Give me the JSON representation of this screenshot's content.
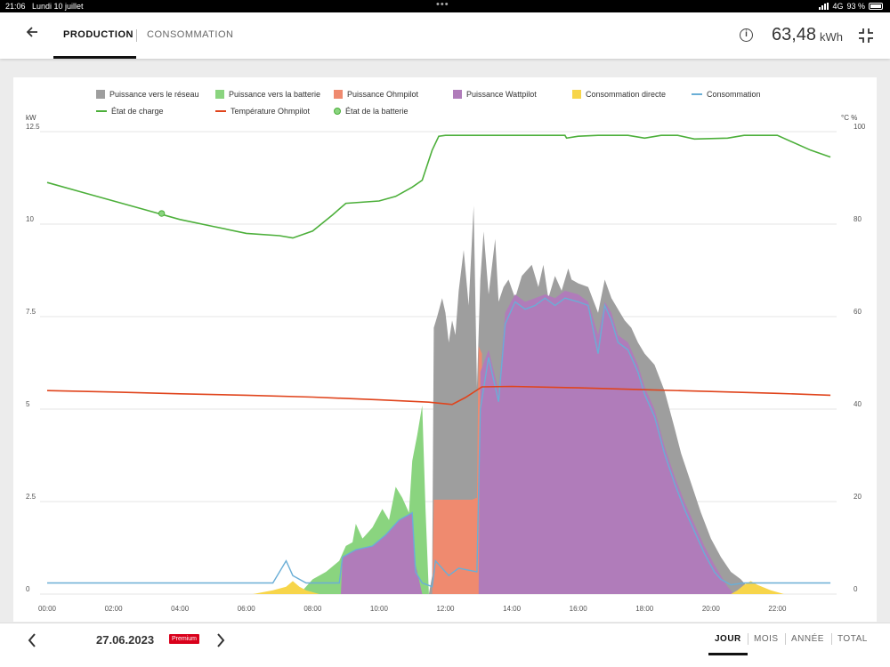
{
  "status_bar": {
    "time": "21:06",
    "date": "Lundi 10 juillet",
    "dots": "•••",
    "network": "4G",
    "battery": "93 %"
  },
  "header": {
    "tabs": [
      {
        "label": "PRODUCTION",
        "active": true
      },
      {
        "label": "CONSOMMATION",
        "active": false
      }
    ],
    "total_value": "63,48",
    "total_unit": "kWh",
    "icons": [
      "back-arrow-icon",
      "info-icon",
      "collapse-icon"
    ]
  },
  "footer": {
    "date": "27.06.2023",
    "badge": "Premium",
    "periods": [
      {
        "label": "JOUR",
        "active": true
      },
      {
        "label": "MOIS",
        "active": false
      },
      {
        "label": "ANNÉE",
        "active": false
      },
      {
        "label": "TOTAL",
        "active": false
      }
    ]
  },
  "chart_data": {
    "type": "area",
    "legend": [
      {
        "label": "Puissance vers le réseau",
        "color": "#9e9e9e",
        "kind": "area"
      },
      {
        "label": "Puissance vers la batterie",
        "color": "#8ad47f",
        "kind": "area"
      },
      {
        "label": "Puissance Ohmpilot",
        "color": "#ef8a6f",
        "kind": "area"
      },
      {
        "label": "Puissance Wattpilot",
        "color": "#b07cba",
        "kind": "area"
      },
      {
        "label": "Consommation directe",
        "color": "#f7d54a",
        "kind": "area"
      },
      {
        "label": "Consommation",
        "color": "#6aaed6",
        "kind": "line"
      },
      {
        "label": "État de charge",
        "color": "#4caf3a",
        "kind": "line"
      },
      {
        "label": "Température Ohmpilot",
        "color": "#e0441c",
        "kind": "line"
      },
      {
        "label": "État de la batterie",
        "color": "#8ad47f",
        "kind": "dot"
      }
    ],
    "y_left": {
      "unit": "kW",
      "min": 0,
      "max": 12.5,
      "ticks": [
        "0",
        "2.5",
        "5",
        "7.5",
        "10",
        "12.5"
      ]
    },
    "y_right": {
      "unit": "°C  %",
      "min": 0,
      "max": 100,
      "ticks": [
        "0",
        "20",
        "40",
        "60",
        "80",
        "100"
      ]
    },
    "x_ticks": [
      "00:00",
      "02:00",
      "04:00",
      "06:00",
      "08:00",
      "10:00",
      "12:00",
      "14:00",
      "16:00",
      "18:00",
      "20:00",
      "22:00"
    ],
    "x_range_hours": [
      0,
      24
    ],
    "grid": true,
    "series": [
      {
        "name": "Puissance vers le réseau",
        "color": "#9e9e9e",
        "points": [
          [
            11.5,
            0
          ],
          [
            11.6,
            0.5
          ],
          [
            11.65,
            7.2
          ],
          [
            11.75,
            7.5
          ],
          [
            11.9,
            8.0
          ],
          [
            12.0,
            7.6
          ],
          [
            12.1,
            6.8
          ],
          [
            12.2,
            7.4
          ],
          [
            12.3,
            7.0
          ],
          [
            12.4,
            8.2
          ],
          [
            12.55,
            9.3
          ],
          [
            12.7,
            7.8
          ],
          [
            12.85,
            10.5
          ],
          [
            12.95,
            5.6
          ],
          [
            13.05,
            8.5
          ],
          [
            13.15,
            9.8
          ],
          [
            13.3,
            8.1
          ],
          [
            13.5,
            9.6
          ],
          [
            13.6,
            7.9
          ],
          [
            13.75,
            8.3
          ],
          [
            13.9,
            8.5
          ],
          [
            14.1,
            8.0
          ],
          [
            14.3,
            8.6
          ],
          [
            14.6,
            8.9
          ],
          [
            14.8,
            8.3
          ],
          [
            14.95,
            8.9
          ],
          [
            15.1,
            8.0
          ],
          [
            15.3,
            8.6
          ],
          [
            15.5,
            8.2
          ],
          [
            15.7,
            8.8
          ],
          [
            15.8,
            8.5
          ],
          [
            16.0,
            8.4
          ],
          [
            16.3,
            8.3
          ],
          [
            16.6,
            7.6
          ],
          [
            16.8,
            8.5
          ],
          [
            17.0,
            8.0
          ],
          [
            17.2,
            7.7
          ],
          [
            17.4,
            7.4
          ],
          [
            17.6,
            7.2
          ],
          [
            17.8,
            6.8
          ],
          [
            18.0,
            6.5
          ],
          [
            18.3,
            6.2
          ],
          [
            18.6,
            5.5
          ],
          [
            18.9,
            4.5
          ],
          [
            19.1,
            3.8
          ],
          [
            19.4,
            3.0
          ],
          [
            19.7,
            2.2
          ],
          [
            20.0,
            1.5
          ],
          [
            20.3,
            1.0
          ],
          [
            20.6,
            0.6
          ],
          [
            20.9,
            0.4
          ],
          [
            21.1,
            0.2
          ],
          [
            21.4,
            0
          ]
        ]
      },
      {
        "name": "Puissance vers la batterie",
        "color": "#8ad47f",
        "points": [
          [
            7.6,
            0
          ],
          [
            8.0,
            0.4
          ],
          [
            8.4,
            0.6
          ],
          [
            8.8,
            0.9
          ],
          [
            9.0,
            1.3
          ],
          [
            9.2,
            1.4
          ],
          [
            9.3,
            1.9
          ],
          [
            9.5,
            1.5
          ],
          [
            9.8,
            1.8
          ],
          [
            10.1,
            2.3
          ],
          [
            10.3,
            2.0
          ],
          [
            10.5,
            2.9
          ],
          [
            10.7,
            2.6
          ],
          [
            10.9,
            2.2
          ],
          [
            11.0,
            3.6
          ],
          [
            11.15,
            4.3
          ],
          [
            11.3,
            5.1
          ],
          [
            11.4,
            2.3
          ],
          [
            11.5,
            0
          ]
        ]
      },
      {
        "name": "Puissance Ohmpilot",
        "color": "#ef8a6f",
        "points": [
          [
            11.6,
            0
          ],
          [
            11.65,
            2.55
          ],
          [
            12.1,
            2.55
          ],
          [
            12.8,
            2.55
          ],
          [
            12.95,
            2.6
          ],
          [
            13.0,
            6.7
          ],
          [
            13.1,
            6.5
          ]
        ]
      },
      {
        "name": "Puissance Wattpilot",
        "color": "#b07cba",
        "points": [
          [
            8.85,
            0
          ],
          [
            8.9,
            1.0
          ],
          [
            9.3,
            1.2
          ],
          [
            9.8,
            1.3
          ],
          [
            10.2,
            1.6
          ],
          [
            10.6,
            2.0
          ],
          [
            11.0,
            2.2
          ],
          [
            11.1,
            0.8
          ],
          [
            11.3,
            0
          ],
          [
            13.0,
            0
          ],
          [
            13.05,
            6.0
          ],
          [
            13.3,
            6.6
          ],
          [
            13.6,
            5.5
          ],
          [
            13.8,
            7.6
          ],
          [
            14.1,
            8.1
          ],
          [
            14.4,
            7.9
          ],
          [
            14.7,
            8.0
          ],
          [
            15.0,
            8.1
          ],
          [
            15.3,
            8.0
          ],
          [
            15.6,
            8.2
          ],
          [
            16.0,
            8.1
          ],
          [
            16.3,
            7.9
          ],
          [
            16.6,
            7.0
          ],
          [
            16.8,
            7.9
          ],
          [
            17.0,
            7.6
          ],
          [
            17.2,
            7.0
          ],
          [
            17.5,
            6.8
          ],
          [
            17.8,
            6.2
          ],
          [
            18.0,
            5.6
          ],
          [
            18.3,
            5.0
          ],
          [
            18.6,
            4.0
          ],
          [
            18.9,
            3.2
          ],
          [
            19.2,
            2.5
          ],
          [
            19.5,
            1.9
          ],
          [
            19.8,
            1.3
          ],
          [
            20.1,
            0.8
          ],
          [
            20.3,
            0.5
          ],
          [
            20.5,
            0.2
          ],
          [
            20.7,
            0
          ]
        ]
      },
      {
        "name": "Consommation directe",
        "color": "#f7d54a",
        "points": [
          [
            6.2,
            0
          ],
          [
            6.8,
            0.1
          ],
          [
            7.2,
            0.2
          ],
          [
            7.4,
            0.35
          ],
          [
            7.6,
            0.2
          ],
          [
            7.8,
            0.1
          ],
          [
            8.2,
            0
          ],
          [
            20.6,
            0
          ],
          [
            20.8,
            0.1
          ],
          [
            21.0,
            0.25
          ],
          [
            21.2,
            0.35
          ],
          [
            21.4,
            0.25
          ],
          [
            21.8,
            0.1
          ],
          [
            22.2,
            0
          ]
        ]
      },
      {
        "name": "Consommation",
        "color": "#6aaed6",
        "points": [
          [
            0,
            0.3
          ],
          [
            1,
            0.3
          ],
          [
            2,
            0.3
          ],
          [
            3,
            0.3
          ],
          [
            4,
            0.3
          ],
          [
            5,
            0.3
          ],
          [
            6,
            0.3
          ],
          [
            6.8,
            0.3
          ],
          [
            7.2,
            0.9
          ],
          [
            7.4,
            0.5
          ],
          [
            7.8,
            0.3
          ],
          [
            8.8,
            0.3
          ],
          [
            8.9,
            1.0
          ],
          [
            9.3,
            1.2
          ],
          [
            9.8,
            1.3
          ],
          [
            10.2,
            1.6
          ],
          [
            10.6,
            2.0
          ],
          [
            11.0,
            2.2
          ],
          [
            11.1,
            0.6
          ],
          [
            11.3,
            0.3
          ],
          [
            11.6,
            0.2
          ],
          [
            11.7,
            0.9
          ],
          [
            12.1,
            0.5
          ],
          [
            12.4,
            0.7
          ],
          [
            12.95,
            0.6
          ],
          [
            13.05,
            5.0
          ],
          [
            13.3,
            6.4
          ],
          [
            13.6,
            5.2
          ],
          [
            13.8,
            7.3
          ],
          [
            14.1,
            7.9
          ],
          [
            14.4,
            7.7
          ],
          [
            14.7,
            7.8
          ],
          [
            15.0,
            8.0
          ],
          [
            15.3,
            7.8
          ],
          [
            15.6,
            8.0
          ],
          [
            16.0,
            7.9
          ],
          [
            16.3,
            7.8
          ],
          [
            16.6,
            6.5
          ],
          [
            16.8,
            7.8
          ],
          [
            17.0,
            7.4
          ],
          [
            17.2,
            6.8
          ],
          [
            17.5,
            6.6
          ],
          [
            17.8,
            6.0
          ],
          [
            18.0,
            5.4
          ],
          [
            18.3,
            4.8
          ],
          [
            18.6,
            3.8
          ],
          [
            18.9,
            3.0
          ],
          [
            19.2,
            2.3
          ],
          [
            19.5,
            1.7
          ],
          [
            19.8,
            1.1
          ],
          [
            20.1,
            0.6
          ],
          [
            20.3,
            0.4
          ],
          [
            20.6,
            0.25
          ],
          [
            21,
            0.3
          ],
          [
            22,
            0.3
          ],
          [
            23,
            0.3
          ],
          [
            23.6,
            0.3
          ]
        ]
      },
      {
        "name": "État de charge",
        "color": "#4caf3a",
        "axis": "right",
        "points": [
          [
            0,
            89
          ],
          [
            1,
            87
          ],
          [
            2,
            85
          ],
          [
            3,
            83
          ],
          [
            4,
            81
          ],
          [
            5,
            79.5
          ],
          [
            6,
            78
          ],
          [
            7,
            77.5
          ],
          [
            7.4,
            77
          ],
          [
            8,
            78.5
          ],
          [
            8.6,
            82
          ],
          [
            9,
            84.5
          ],
          [
            10,
            85
          ],
          [
            10.5,
            86
          ],
          [
            11,
            88
          ],
          [
            11.3,
            89.5
          ],
          [
            11.6,
            96
          ],
          [
            11.8,
            99
          ],
          [
            12,
            99.2
          ],
          [
            13,
            99.2
          ],
          [
            14,
            99.2
          ],
          [
            15,
            99.2
          ],
          [
            15.6,
            99.2
          ],
          [
            15.65,
            98.6
          ],
          [
            16,
            99
          ],
          [
            16.6,
            99.2
          ],
          [
            17.5,
            99.2
          ],
          [
            18,
            98.6
          ],
          [
            18.5,
            99.2
          ],
          [
            19,
            99.2
          ],
          [
            19.5,
            98.4
          ],
          [
            20,
            98.5
          ],
          [
            20.5,
            98.6
          ],
          [
            21,
            99.2
          ],
          [
            22,
            99.2
          ],
          [
            23,
            96
          ],
          [
            23.6,
            94.5
          ]
        ]
      },
      {
        "name": "Température Ohmpilot",
        "color": "#e0441c",
        "axis": "right",
        "points": [
          [
            0,
            44
          ],
          [
            2,
            43.7
          ],
          [
            4,
            43.3
          ],
          [
            6,
            43
          ],
          [
            8,
            42.6
          ],
          [
            10,
            42
          ],
          [
            11.5,
            41.5
          ],
          [
            12.2,
            41
          ],
          [
            12.6,
            42.5
          ],
          [
            13.1,
            44.8
          ],
          [
            14,
            44.9
          ],
          [
            16,
            44.6
          ],
          [
            18,
            44.2
          ],
          [
            20,
            43.8
          ],
          [
            22,
            43.4
          ],
          [
            23.6,
            43
          ]
        ]
      }
    ],
    "battery_state_marker": {
      "x_hour": 3.45,
      "y_percent": 82.3
    }
  }
}
